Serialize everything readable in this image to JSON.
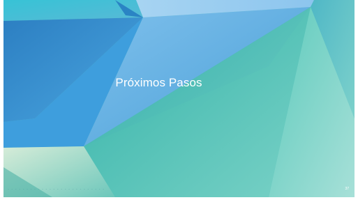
{
  "slide": {
    "title": "Próximos Pasos",
    "footer": "- - - - - - - - - - - - - - - - - - - - - - - - - -",
    "number": "37"
  },
  "colors": {
    "frame": "#ffffff",
    "teal": "#5cc5c0",
    "blue": "#4aa5dc",
    "dark_blue": "#2f78b6",
    "light_blue": "#8fc9ee",
    "mint": "#a2dcd5",
    "title_text": "#ffffff"
  }
}
